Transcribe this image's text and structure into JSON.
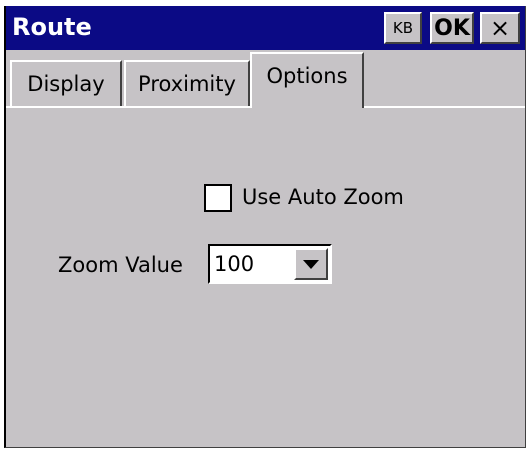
{
  "window": {
    "title": "Route",
    "buttons": {
      "kb_label": "KB",
      "ok_label": "OK",
      "close_label": "×"
    }
  },
  "tabs": [
    {
      "label": "Display",
      "selected": false
    },
    {
      "label": "Proximity",
      "selected": false
    },
    {
      "label": "Options",
      "selected": true
    }
  ],
  "options": {
    "auto_zoom": {
      "label": "Use Auto Zoom",
      "checked": false
    },
    "zoom_value": {
      "label": "Zoom Value",
      "selected": "100"
    }
  },
  "colors": {
    "titlebar": "#0b0a85",
    "face": "#c6c3c6"
  },
  "icons": {
    "close": "close-icon",
    "dropdown": "chevron-down-icon"
  }
}
